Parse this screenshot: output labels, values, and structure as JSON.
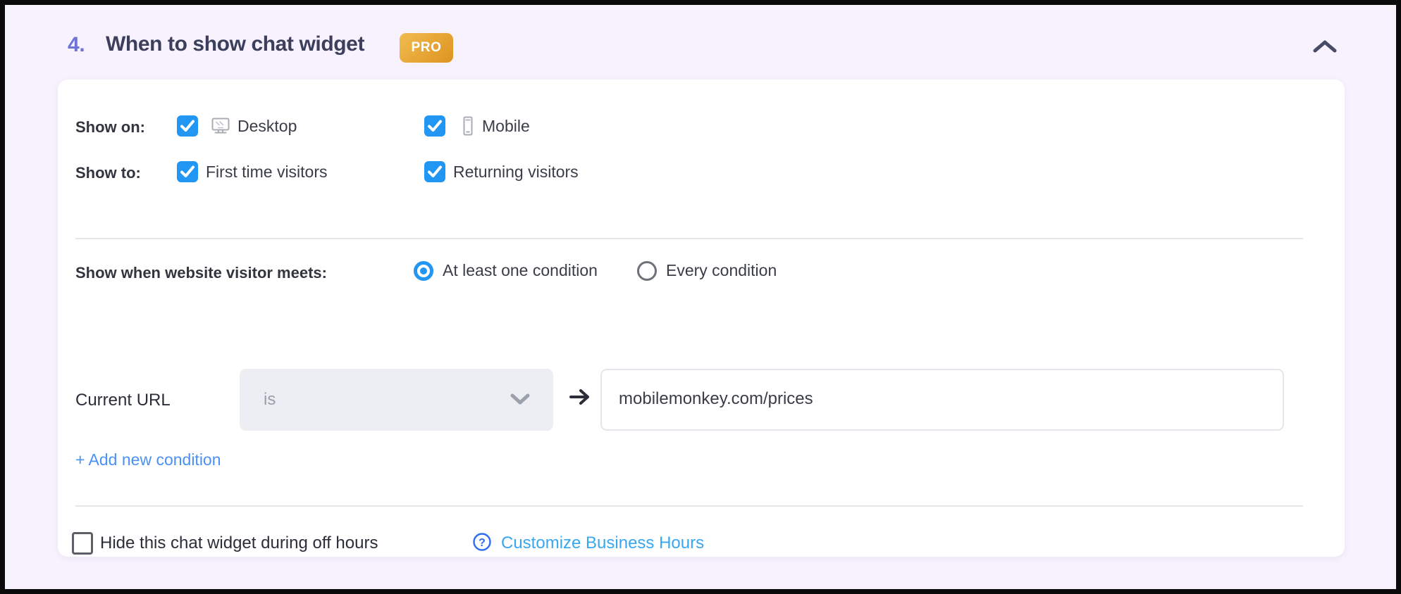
{
  "section": {
    "number": "4.",
    "title": "When to show chat widget",
    "badge": "PRO",
    "collapse_icon": "chevron-up-icon",
    "number_color": "#6c74d8",
    "title_color": "#3b3f5c",
    "badge_color": "#e9a93a"
  },
  "show_on": {
    "label": "Show on:",
    "options": [
      {
        "label": "Desktop",
        "checked": true,
        "icon": "desktop-monitor-icon"
      },
      {
        "label": "Mobile",
        "checked": true,
        "icon": "mobile-phone-icon"
      }
    ]
  },
  "show_to": {
    "label": "Show to:",
    "options": [
      {
        "label": "First time visitors",
        "checked": true
      },
      {
        "label": "Returning visitors",
        "checked": true
      }
    ]
  },
  "conditions": {
    "label": "Show when website visitor meets:",
    "match_options": [
      {
        "label": "At least one condition",
        "selected": true
      },
      {
        "label": "Every condition",
        "selected": false
      }
    ],
    "rule": {
      "field_label": "Current URL",
      "operator_value": "is",
      "operator_icon": "chevron-down-icon",
      "arrow_icon": "arrow-right-icon",
      "value": "mobilemonkey.com/prices",
      "value_placeholder": "Enter URL"
    },
    "add_link": "+ Add new condition",
    "add_link_color": "#4a90f5"
  },
  "off_hours": {
    "checkbox_label": "Hide this chat widget during off hours",
    "checked": false,
    "help_icon": "question-mark-circle-icon",
    "link_label": "Customize Business Hours",
    "link_color": "#39a7f0"
  },
  "theme": {
    "accent_blue": "#2196f3",
    "page_background": "#f7f2fd",
    "card_background": "#ffffff",
    "divider": "#e6e6ea"
  }
}
